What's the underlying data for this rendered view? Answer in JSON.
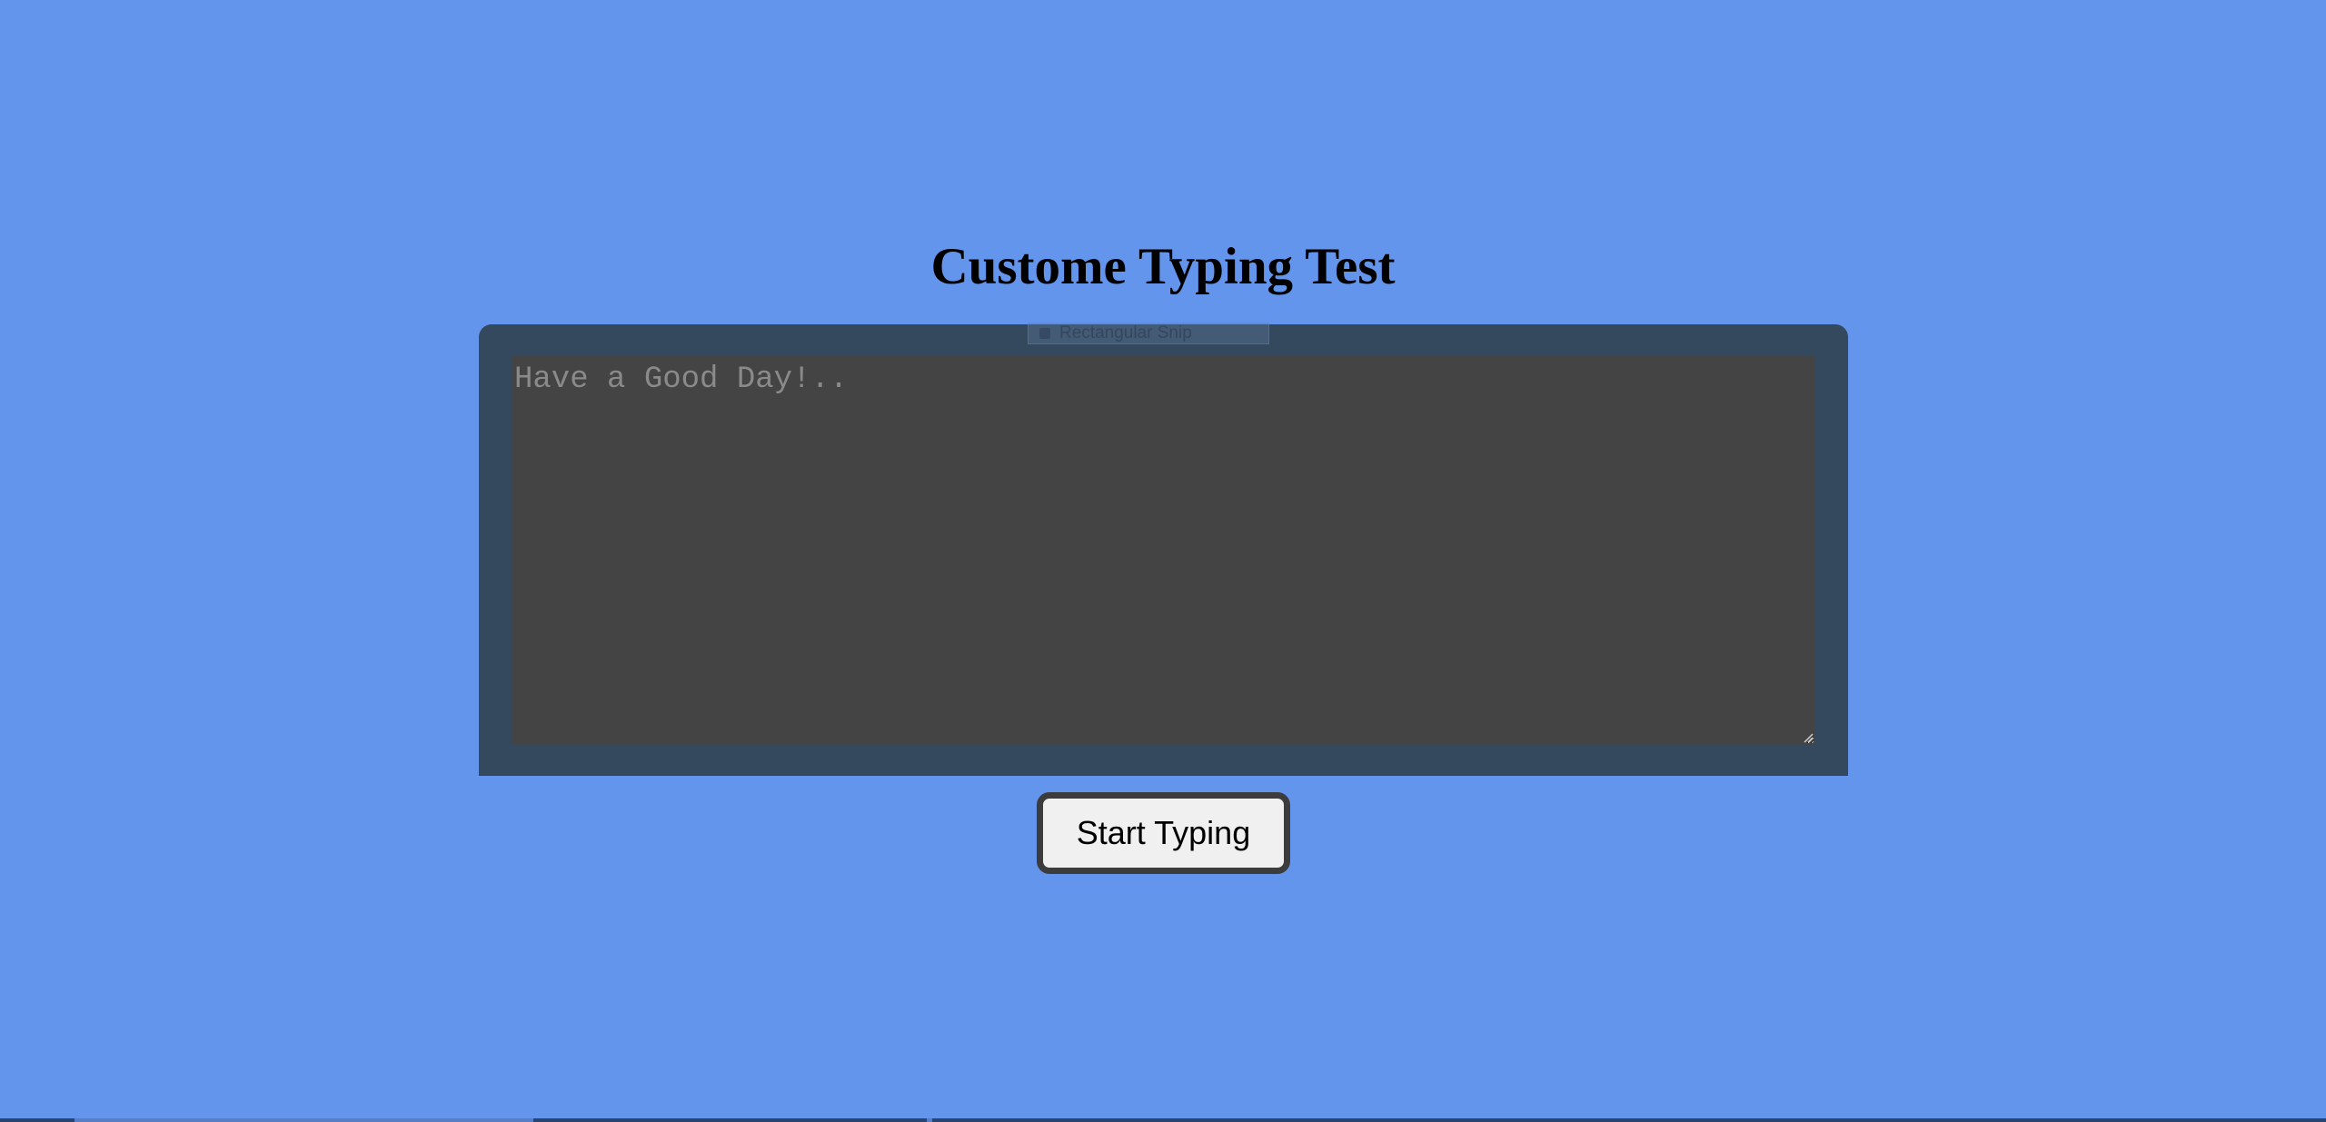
{
  "page": {
    "title": "Custome Typing Test",
    "background_color": "#6495ed"
  },
  "typing_panel": {
    "background_color": "#34495e",
    "textarea_placeholder": "Have a Good Day!..",
    "textarea_value": "",
    "textarea_color": "#444444"
  },
  "snip_overlay": {
    "label": "Rectangular Snip",
    "icon": "snip-mode-icon"
  },
  "actions": {
    "start_label": "Start Typing"
  },
  "icons": {
    "resize_grip": "resize-grip-icon"
  }
}
